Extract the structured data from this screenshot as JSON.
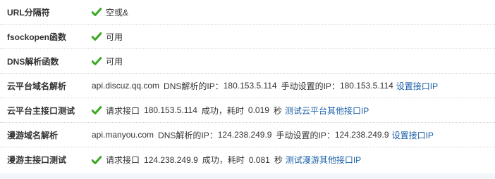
{
  "colors": {
    "link": "#1a5fa8",
    "check": "#3aa823",
    "text": "#333333"
  },
  "rows": [
    {
      "label": "URL分隔符",
      "icon": "check-icon",
      "text": "空或&"
    },
    {
      "label": "fsockopen函数",
      "icon": "check-icon",
      "text": "可用"
    },
    {
      "label": "DNS解析函数",
      "icon": "check-icon",
      "text": "可用"
    },
    {
      "label": "云平台域名解析",
      "host": "api.discuz.qq.com",
      "dns_label": "DNS解析的IP：",
      "dns_ip": "180.153.5.114",
      "manual_label": "手动设置的IP：",
      "manual_ip": "180.153.5.114",
      "link": "设置接口IP"
    },
    {
      "label": "云平台主接口测试",
      "icon": "check-icon",
      "text": "请求接口",
      "ip": "180.153.5.114",
      "result": "成功，耗时",
      "time": "0.019",
      "unit": "秒",
      "link": "测试云平台其他接口IP"
    },
    {
      "label": "漫游域名解析",
      "host": "api.manyou.com",
      "dns_label": "DNS解析的IP：",
      "dns_ip": "124.238.249.9",
      "manual_label": "手动设置的IP：",
      "manual_ip": "124.238.249.9",
      "link": "设置接口IP"
    },
    {
      "label": "漫游主接口测试",
      "icon": "check-icon",
      "text": "请求接口",
      "ip": "124.238.249.9",
      "result": "成功，耗时",
      "time": "0.081",
      "unit": "秒",
      "link": "测试漫游其他接口IP"
    }
  ]
}
